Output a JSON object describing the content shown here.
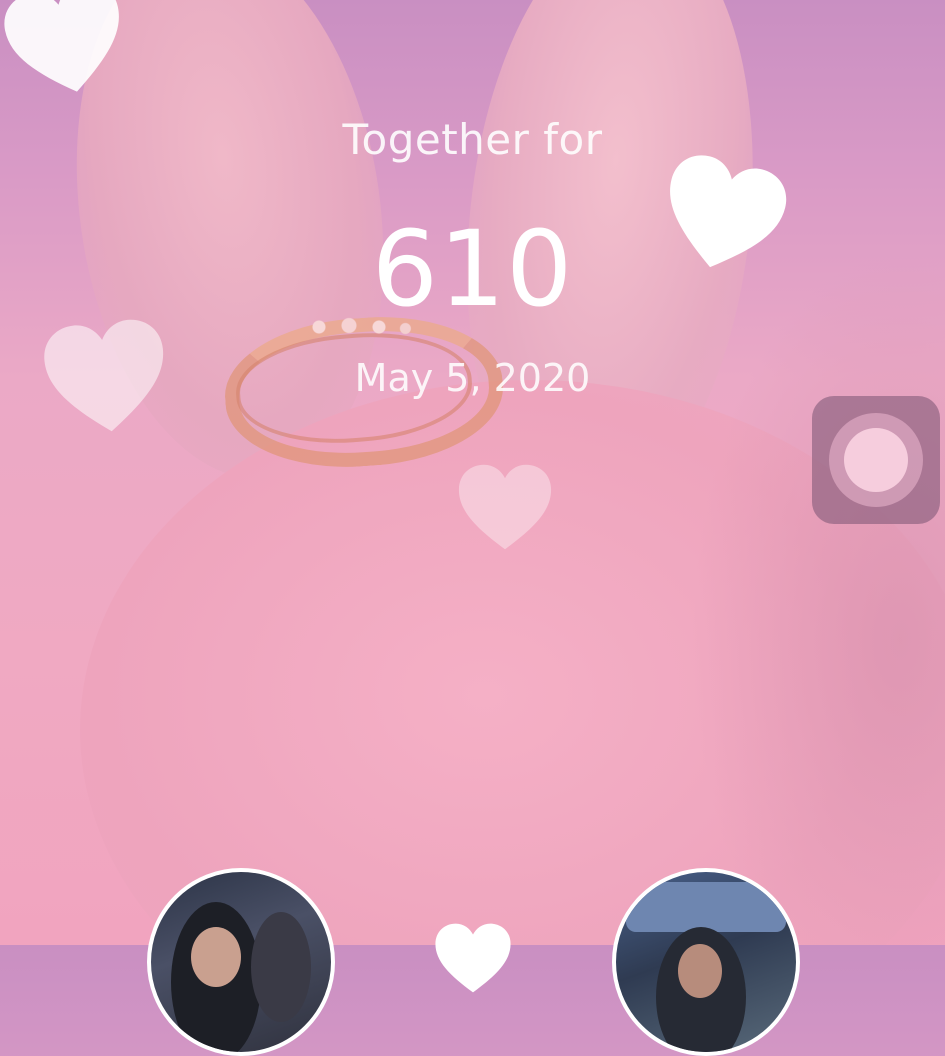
{
  "widget": {
    "subtitle": "Together for",
    "day_count": "610",
    "start_date": "May 5, 2020"
  },
  "icons": {
    "floating_button": "assistive-touch-icon",
    "decorations": [
      "heart-icon",
      "heart-icon",
      "heart-icon",
      "heart-icon",
      "heart-icon"
    ]
  },
  "colors": {
    "text": "#ffffff",
    "background": "#f0a9c2",
    "heart": "#ffffff",
    "floating_button": "#8a5a7a"
  }
}
